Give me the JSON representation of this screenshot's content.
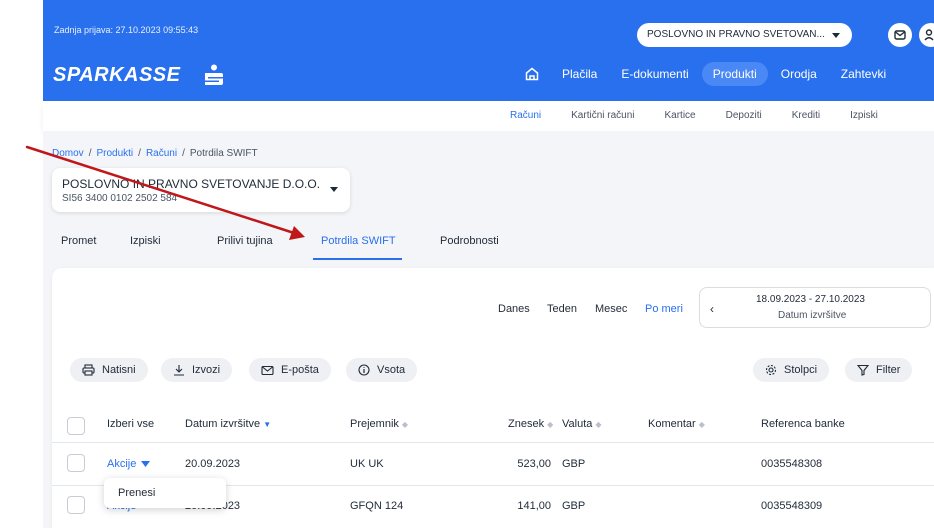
{
  "header": {
    "last_login": "Zadnja prijava: 27.10.2023 09:55:43",
    "company_selector": "POSLOVNO IN PRAVNO SVETOVAN...",
    "logo_text": "SPARKASSE",
    "nav": [
      "Plačila",
      "E-dokumenti",
      "Produkti",
      "Orodja",
      "Zahtevki"
    ],
    "nav_active": "Produkti"
  },
  "subnav": [
    "Računi",
    "Kartični računi",
    "Kartice",
    "Depoziti",
    "Krediti",
    "Izpiski"
  ],
  "breadcrumb": {
    "home": "Domov",
    "products": "Produkti",
    "accounts": "Računi",
    "current": "Potrdila SWIFT",
    "separator": "/"
  },
  "account": {
    "name": "POSLOVNO IN PRAVNO SVETOVANJE D.O.O.",
    "iban": "SI56 3400 0102 2502 584"
  },
  "tabs": [
    "Promet",
    "Izpiski",
    "Prilivi tujina",
    "Potrdila SWIFT",
    "Podrobnosti"
  ],
  "period": {
    "options": [
      "Danes",
      "Teden",
      "Mesec",
      "Po meri"
    ],
    "active": "Po meri",
    "range": "18.09.2023 - 27.10.2023",
    "range_label": "Datum izvršitve",
    "prev_glyph": "‹"
  },
  "actions": {
    "print": "Natisni",
    "export": "Izvozi",
    "email": "E-pošta",
    "sum": "Vsota",
    "columns": "Stolpci",
    "filter": "Filter"
  },
  "table": {
    "headers": {
      "select_all": "Izberi vse",
      "date": "Datum izvršitve",
      "recipient": "Prejemnik",
      "amount": "Znesek",
      "currency": "Valuta",
      "comment": "Komentar",
      "reference": "Referenca banke"
    },
    "rows": [
      {
        "actions": "Akcije",
        "date": "20.09.2023",
        "recipient": "UK UK",
        "amount": "523,00",
        "currency": "GBP",
        "comment": "",
        "reference": "0035548308"
      },
      {
        "actions": "Akcije",
        "date": "20.09.2023",
        "recipient": "GFQN 124",
        "amount": "141,00",
        "currency": "GBP",
        "comment": "",
        "reference": "0035548309"
      }
    ],
    "row_menu": [
      "Prenesi"
    ]
  },
  "colors": {
    "brand": "#2870ed",
    "annotation_arrow": "#c0171b"
  }
}
